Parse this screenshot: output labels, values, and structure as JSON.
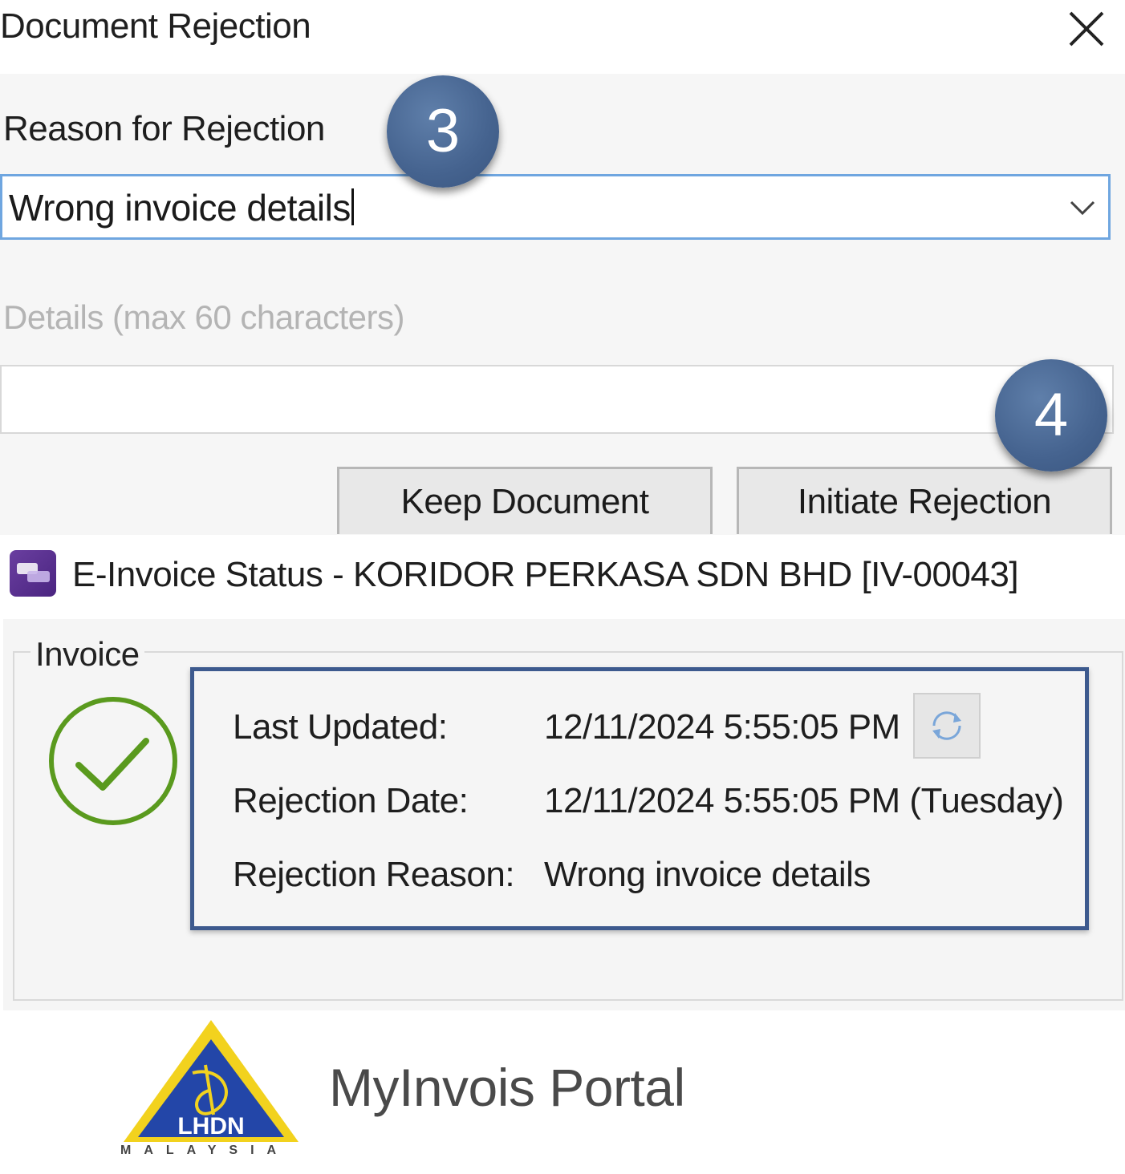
{
  "dialog": {
    "title": "Document Rejection",
    "reason_label": "Reason for Rejection",
    "reason_value": "Wrong invoice details",
    "details_label": "Details (max 60 characters)",
    "details_value": "",
    "keep_button": "Keep Document",
    "initiate_button": "Initiate Rejection"
  },
  "steps": {
    "three": "3",
    "four": "4"
  },
  "status_window": {
    "title": "E-Invoice Status - KORIDOR PERKASA SDN BHD [IV-00043]",
    "group_label": "Invoice",
    "rows": [
      {
        "label": "Last Updated:",
        "value": "12/11/2024 5:55:05 PM"
      },
      {
        "label": "Rejection Date:",
        "value": "12/11/2024 5:55:05 PM (Tuesday)"
      },
      {
        "label": "Rejection Reason:",
        "value": "Wrong invoice details"
      }
    ]
  },
  "footer": {
    "logo_text": "LHDN",
    "logo_subtext": "MALAYSIA",
    "portal_name": "MyInvois Portal"
  },
  "colors": {
    "accent_border": "#3d5a8e",
    "step_badge": "#45638f",
    "success_green": "#5a9a1e",
    "combo_focus": "#6fa6e0"
  },
  "icons": [
    "close-icon",
    "chevron-down-icon",
    "app-icon",
    "check-circle-icon",
    "refresh-icon",
    "lhdn-logo"
  ]
}
